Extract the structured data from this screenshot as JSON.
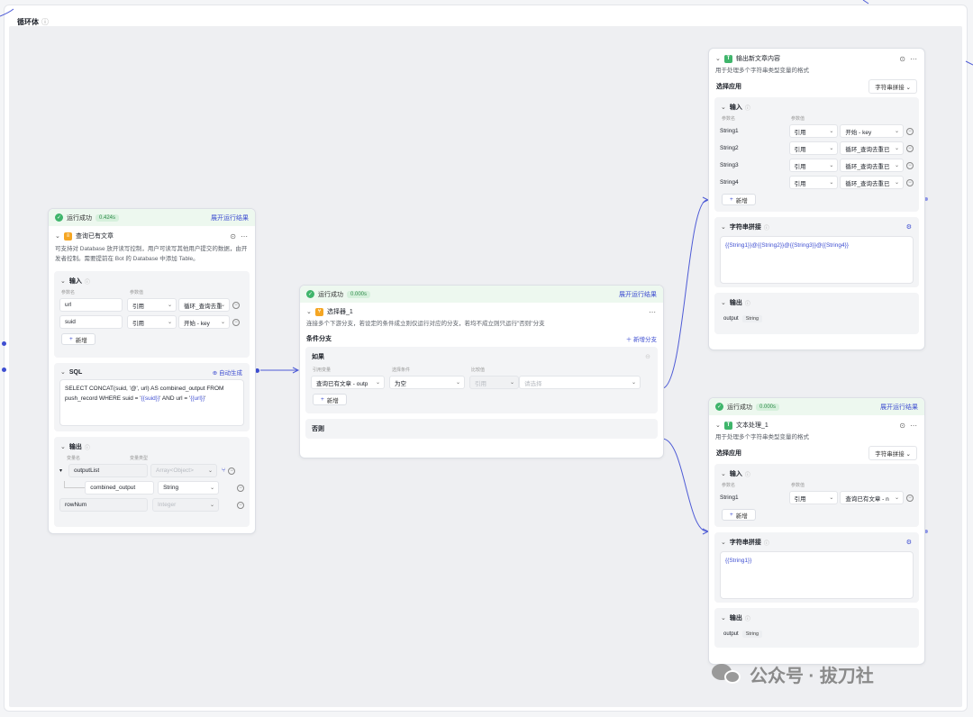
{
  "loop": {
    "title": "循环体",
    "info_icon": "info-icon"
  },
  "common": {
    "run_success": "运行成功",
    "expand": "展开运行结果",
    "add": "新增",
    "param_name": "参数名",
    "param_value": "参数值",
    "ref": "引用",
    "var_name": "变量名",
    "var_type": "变量类型",
    "input": "输入",
    "output": "输出"
  },
  "db_node": {
    "time": "0.424s",
    "title": "查询已有文章",
    "desc": "可支持对 Database 放开读写控制，用户可读写其他用户提交的数据，由开发者控制。需要提前在 Bot 的 Database 中添加 Table。",
    "inputs": [
      {
        "name": "url",
        "type": "引用",
        "value": "循环_查询去重"
      },
      {
        "name": "suid",
        "type": "引用",
        "value": "开始 - key"
      }
    ],
    "sql_label": "SQL",
    "auto_gen": "自动生成",
    "sql": "SELECT CONCAT(suid, '@', url) AS combined_output FROM push_record WHERE suid = '",
    "sql_v1": "{{suid}}",
    "sql_mid": "' AND url = '",
    "sql_v2": "{{url}}",
    "sql_end": "'",
    "outputs": [
      {
        "name": "outputList",
        "type": "Array<Object>"
      },
      {
        "name": "combined_output",
        "type": "String"
      },
      {
        "name": "rowNum",
        "type": "Integer"
      }
    ]
  },
  "sel_node": {
    "time": "0.000s",
    "title": "选择器_1",
    "desc": "连接多个下游分支，若设定的条件成立则仅运行对应的分支，若均不成立则只运行\"否则\"分支",
    "branch": "条件分支",
    "add_branch": "新增分支",
    "if": "如果",
    "col_ref": "引用变量",
    "col_cond": "选择条件",
    "col_cmp": "比较值",
    "ref_val": "查询已有文章 - outp",
    "cond": "为空",
    "cmp_type": "引用",
    "cmp_ph": "请选择",
    "else": "否则"
  },
  "out_node": {
    "title": "输出新文章内容",
    "desc": "用于处理多个字符串类型变量的格式",
    "select_app": "选择应用",
    "app": "字符串拼接",
    "inputs": [
      {
        "name": "String1",
        "type": "引用",
        "value": "开始 - key"
      },
      {
        "name": "String2",
        "type": "引用",
        "value": "循环_查询去重已"
      },
      {
        "name": "String3",
        "type": "引用",
        "value": "循环_查询去重已"
      },
      {
        "name": "String4",
        "type": "引用",
        "value": "循环_查询去重已"
      }
    ],
    "concat_label": "字符串拼接",
    "concat": "{{String1}}@{{String2}}@{{String3}}@{{String4}}",
    "out_name": "output",
    "out_type": "String"
  },
  "txt_node": {
    "time": "0.000s",
    "title": "文本处理_1",
    "desc": "用于处理多个字符串类型变量的格式",
    "select_app": "选择应用",
    "app": "字符串拼接",
    "inputs": [
      {
        "name": "String1",
        "type": "引用",
        "value": "查询已有文章 - n"
      }
    ],
    "concat_label": "字符串拼接",
    "concat": "{{String1}}",
    "out_name": "output",
    "out_type": "String"
  },
  "watermark": "公众号 · 拔刀社",
  "colors": {
    "accent": "#3e4ed1",
    "success": "#3fb56b",
    "canvas": "#eeeff2"
  }
}
